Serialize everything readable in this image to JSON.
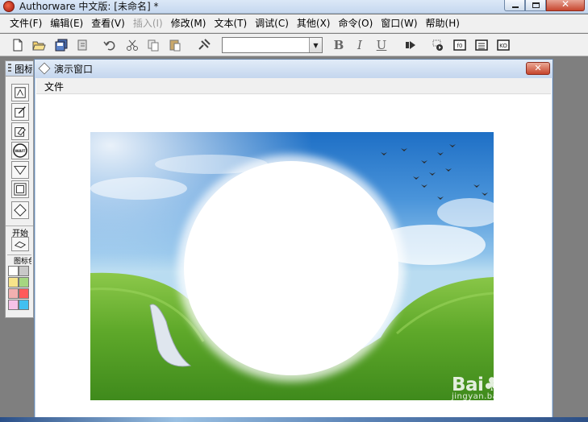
{
  "window": {
    "title": "Authorware 中文版: [未命名] *"
  },
  "menubar": {
    "items": [
      {
        "label": "文件(F)",
        "enabled": true
      },
      {
        "label": "编辑(E)",
        "enabled": true
      },
      {
        "label": "查看(V)",
        "enabled": true
      },
      {
        "label": "插入(I)",
        "enabled": false
      },
      {
        "label": "修改(M)",
        "enabled": true
      },
      {
        "label": "文本(T)",
        "enabled": true
      },
      {
        "label": "调试(C)",
        "enabled": true
      },
      {
        "label": "其他(X)",
        "enabled": true
      },
      {
        "label": "命令(O)",
        "enabled": true
      },
      {
        "label": "窗口(W)",
        "enabled": true
      },
      {
        "label": "帮助(H)",
        "enabled": true
      }
    ]
  },
  "toolbar": {
    "font_select_value": "",
    "bold_label": "B",
    "italic_label": "I",
    "underline_label": "U",
    "icons": [
      "new-file-icon",
      "open-folder-icon",
      "save-all-icon",
      "import-icon",
      "undo-icon",
      "cut-icon",
      "copy-icon",
      "paste-icon",
      "find-icon",
      "play-icon",
      "control-panel-icon",
      "function-icon",
      "variable-icon",
      "knowledge-object-icon"
    ]
  },
  "palette": {
    "title": "图标",
    "start_label": "开始",
    "color_label": "图标色彩",
    "icons": [
      "display-icon",
      "motion-icon",
      "erase-icon",
      "wait-icon",
      "navigate-icon",
      "framework-icon",
      "decision-icon",
      "interaction-icon"
    ],
    "wait_label": "WAIT",
    "swatches": [
      "#ffffff",
      "#c8c8c8",
      "#f7e48a",
      "#a5d680",
      "#f2b0b0",
      "#ff5a5a",
      "#f6c2e8",
      "#41c0f0",
      "#2f7de0",
      "#ffb74d"
    ]
  },
  "presentation_window": {
    "title": "演示窗口",
    "menu_file": "文件",
    "close_label": "✕"
  },
  "watermark": {
    "logo": "Bai♣经验",
    "url": "jingyan.baidu.com"
  },
  "colors": {
    "titlebar": "#c6d8ef",
    "close_red": "#c7462f",
    "chrome_gray": "#f0f0f0",
    "desktop_gray": "#7f7f7f"
  }
}
